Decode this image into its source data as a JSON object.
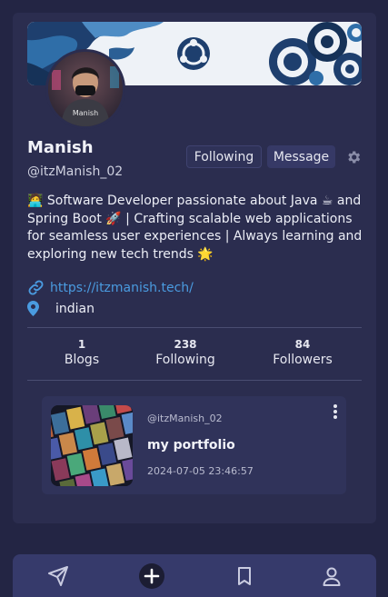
{
  "profile": {
    "name": "Manish",
    "handle": "@itzManish_02",
    "bio": "🧑‍💻 Software Developer passionate about Java ☕ and Spring Boot 🚀 | Crafting scalable web applications for seamless user experiences | Always learning and exploring new tech trends 🌟",
    "website": "https://itzmanish.tech/",
    "location": "indian",
    "avatar_text": "Manish"
  },
  "actions": {
    "following_label": "Following",
    "message_label": "Message"
  },
  "stats": [
    {
      "value": "1",
      "label": "Blogs"
    },
    {
      "value": "238",
      "label": "Following"
    },
    {
      "value": "84",
      "label": "Followers"
    }
  ],
  "post": {
    "author": "@itzManish_02",
    "title": "my portfolio",
    "date": "2024-07-05 23:46:57"
  },
  "icons": {
    "settings": "gear-icon",
    "link": "link-icon",
    "location": "map-pin-icon",
    "more": "kebab-menu-icon",
    "nav": [
      "send-icon",
      "plus-icon",
      "bookmark-icon",
      "user-icon"
    ]
  },
  "colors": {
    "background": "#232544",
    "card": "#2b2d4f",
    "link": "#4a9be0",
    "navbar": "#363a6b"
  }
}
